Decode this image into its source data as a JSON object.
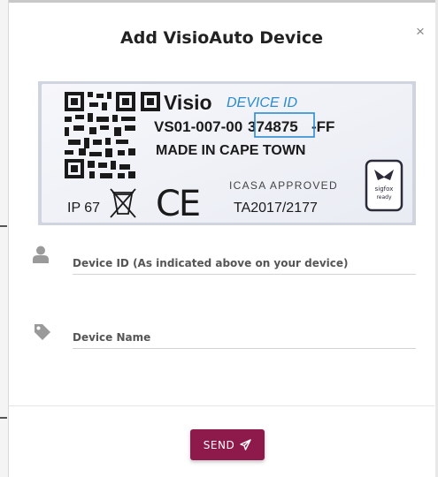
{
  "modal": {
    "title": "Add VisioAuto Device",
    "close_glyph": "×"
  },
  "device_label_image": {
    "brand": "Visio",
    "device_id_caption": "DEVICE ID",
    "serial_prefix": "VS01-007-00",
    "serial_device_id": "374875",
    "serial_suffix": "-FF",
    "origin": "MADE IN CAPE TOWN",
    "ip_rating": "IP 67",
    "ce_mark": "CE",
    "approval": "ICASA APPROVED",
    "approval_number": "TA2017/2177",
    "sigfox_text_1": "sigfox",
    "sigfox_text_2": "ready",
    "highlight_color": "#2a8ccf"
  },
  "form": {
    "device_id_placeholder": "Device ID (As indicated above on your device)",
    "device_name_placeholder": "Device Name"
  },
  "icons": {
    "device_id_field": "user-icon",
    "device_name_field": "tag-icon",
    "send_button": "paper-plane-icon",
    "close": "close-icon"
  },
  "footer": {
    "send_label": "SEND"
  },
  "colors": {
    "send_button": "#8d1a4b",
    "icon_gray": "#9a9a9a"
  }
}
